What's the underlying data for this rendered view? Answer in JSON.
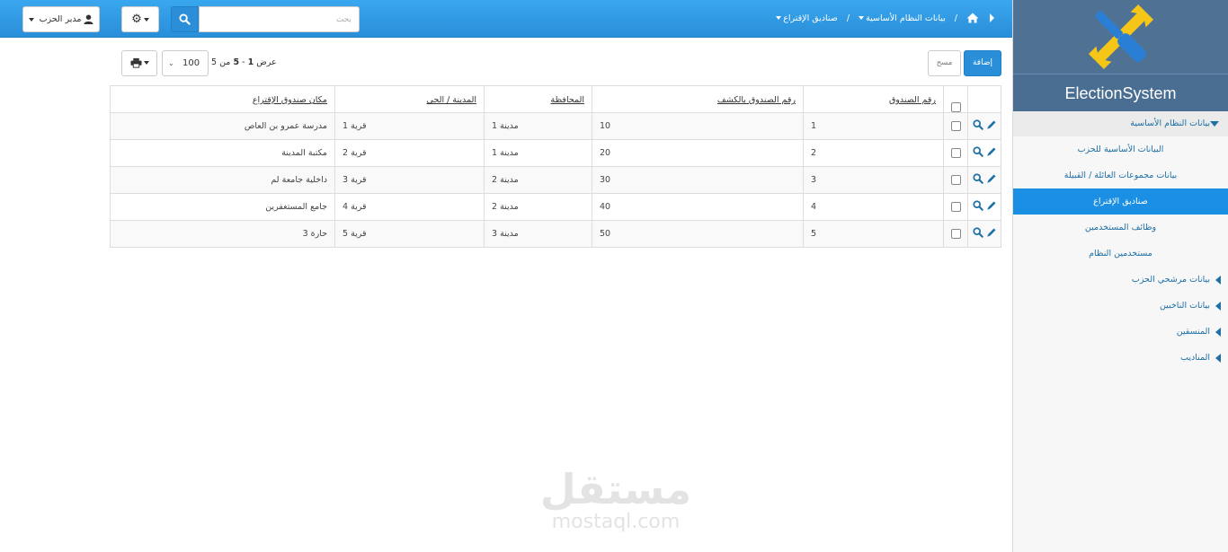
{
  "sidebar": {
    "brand": "ElectionSystem",
    "items": [
      {
        "label": "بيانات النظام الأساسية",
        "state": "open"
      },
      {
        "label": "البيانات الأساسية للحزب",
        "state": "sub"
      },
      {
        "label": "بيانات مجموعات العائلة / القبيلة",
        "state": "sub"
      },
      {
        "label": "صناديق الإقتراع",
        "state": "active"
      },
      {
        "label": "وظائف المستخدمين",
        "state": "sub"
      },
      {
        "label": "مستخدمين النظام",
        "state": "sub"
      },
      {
        "label": "بيانات مرشحي الحزب",
        "state": "closed"
      },
      {
        "label": "بيانات الناخبين",
        "state": "closed"
      },
      {
        "label": "المنسقين",
        "state": "closed"
      },
      {
        "label": "المناديب",
        "state": "closed"
      }
    ]
  },
  "topbar": {
    "user_label": "مدير الحزب",
    "search_placeholder": "بحث",
    "breadcrumb": [
      "بيانات النظام الأساسية",
      "صناديق الإقتراع"
    ]
  },
  "toolbar": {
    "add_label": "إضافة",
    "clear_label": "مسح",
    "page_size": "100",
    "pager": {
      "prefix": "عرض",
      "from": "1",
      "dash": "-",
      "to": "5",
      "of": "من",
      "total": "5"
    }
  },
  "table": {
    "headers": [
      "رقم الصندوق",
      "رقم الصندوق بالكشف",
      "المحافظة",
      "المدينة / الحي",
      "مكان صندوق الإقتراع"
    ],
    "rows": [
      [
        "1",
        "10",
        "مدينة 1",
        "قرية 1",
        "مدرسة عمرو بن العاص"
      ],
      [
        "2",
        "20",
        "مدينة 1",
        "قرية 2",
        "مكتبة المدينة"
      ],
      [
        "3",
        "30",
        "مدينة 2",
        "قرية 3",
        "داخلية جامعة لم"
      ],
      [
        "4",
        "40",
        "مدينة 2",
        "قرية 4",
        "جامع المستغفرين"
      ],
      [
        "5",
        "50",
        "مدينة 3",
        "قرية 5",
        "حارة 3"
      ]
    ]
  },
  "watermark": {
    "arabic": "مستقل",
    "latin": "mostaql.com"
  },
  "colors": {
    "topbar": "#2a8ed9",
    "sidebar_header": "#4f7294",
    "active": "#1a8fe3",
    "link": "#1d6fa5",
    "logo_yellow": "#f5c518",
    "logo_blue": "#2a7fd4"
  }
}
